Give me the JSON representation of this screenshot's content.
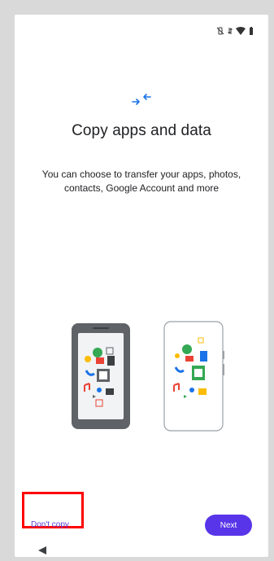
{
  "status_bar": {
    "icons": [
      "vibrate-off-icon",
      "data-arrows-icon",
      "wifi-icon",
      "battery-icon"
    ]
  },
  "header": {
    "icon": "transfer-arrows-icon",
    "title": "Copy apps and data",
    "subtitle": "You can choose to transfer your apps, photos, contacts, Google Account and more"
  },
  "illustration": {
    "name": "phones-transfer-illustration"
  },
  "actions": {
    "dont_copy_label": "Don't copy",
    "next_label": "Next"
  },
  "colors": {
    "accent": "#5835e8",
    "link": "#5b3fd0",
    "highlight": "#ff0000"
  },
  "nav": {
    "back_icon": "back-triangle-icon"
  }
}
